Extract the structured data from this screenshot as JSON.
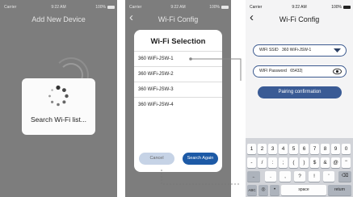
{
  "status": {
    "carrier": "Carrier",
    "time": "9:22 AM",
    "battery": "100%"
  },
  "screen1": {
    "title": "Add New Device",
    "loader_text": "Search Wi-Fi list..."
  },
  "screen2": {
    "title": "Wi-Fi Config",
    "back_icon": "chevron-left-icon",
    "dialog_title": "Wi-Fi Selection",
    "networks": [
      "360 WiFi-JSW-1",
      "360 WiFi-JSW-2",
      "360 WiFi-JSW-3",
      "360 WiFi-JSW-4"
    ],
    "cancel_label": "Cancel",
    "search_again_label": "Search Again"
  },
  "screen3": {
    "title": "Wi-Fi Config",
    "back_icon": "chevron-left-icon",
    "ssid_label": "WIFI SSID",
    "ssid_value": "360 WiFi-JSW-1",
    "password_label": "WIFI Password",
    "password_value": "65432|",
    "confirm_label": "Pairing confirmation",
    "keyboard": {
      "row1": [
        "1",
        "2",
        "3",
        "4",
        "5",
        "6",
        "7",
        "8",
        "9",
        "0"
      ],
      "row2": [
        "-",
        "/",
        ":",
        ";",
        "(",
        ")",
        "$",
        "&",
        "@",
        "\""
      ],
      "row3": [
        ".",
        ",",
        "?",
        "!",
        "'"
      ],
      "abc": "ABC",
      "space": "space",
      "return": "return"
    }
  }
}
